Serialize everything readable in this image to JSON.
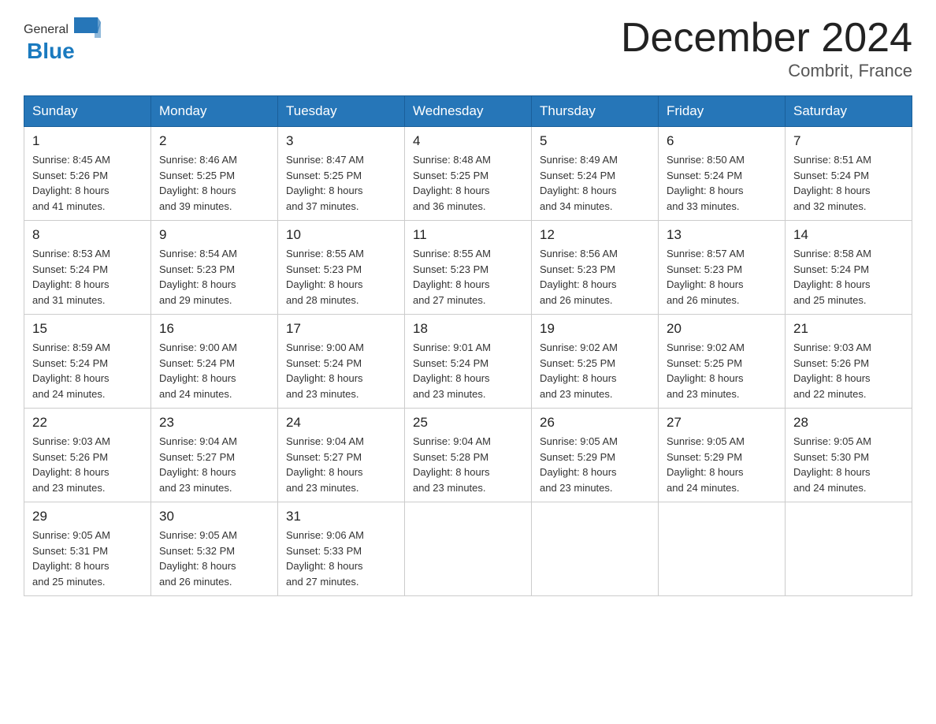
{
  "header": {
    "logo": {
      "general": "General",
      "blue": "Blue",
      "flag_alt": "GeneralBlue logo flag"
    },
    "title": "December 2024",
    "location": "Combrit, France"
  },
  "days_of_week": [
    "Sunday",
    "Monday",
    "Tuesday",
    "Wednesday",
    "Thursday",
    "Friday",
    "Saturday"
  ],
  "weeks": [
    [
      {
        "day": "1",
        "sunrise": "Sunrise: 8:45 AM",
        "sunset": "Sunset: 5:26 PM",
        "daylight": "Daylight: 8 hours",
        "daylight2": "and 41 minutes."
      },
      {
        "day": "2",
        "sunrise": "Sunrise: 8:46 AM",
        "sunset": "Sunset: 5:25 PM",
        "daylight": "Daylight: 8 hours",
        "daylight2": "and 39 minutes."
      },
      {
        "day": "3",
        "sunrise": "Sunrise: 8:47 AM",
        "sunset": "Sunset: 5:25 PM",
        "daylight": "Daylight: 8 hours",
        "daylight2": "and 37 minutes."
      },
      {
        "day": "4",
        "sunrise": "Sunrise: 8:48 AM",
        "sunset": "Sunset: 5:25 PM",
        "daylight": "Daylight: 8 hours",
        "daylight2": "and 36 minutes."
      },
      {
        "day": "5",
        "sunrise": "Sunrise: 8:49 AM",
        "sunset": "Sunset: 5:24 PM",
        "daylight": "Daylight: 8 hours",
        "daylight2": "and 34 minutes."
      },
      {
        "day": "6",
        "sunrise": "Sunrise: 8:50 AM",
        "sunset": "Sunset: 5:24 PM",
        "daylight": "Daylight: 8 hours",
        "daylight2": "and 33 minutes."
      },
      {
        "day": "7",
        "sunrise": "Sunrise: 8:51 AM",
        "sunset": "Sunset: 5:24 PM",
        "daylight": "Daylight: 8 hours",
        "daylight2": "and 32 minutes."
      }
    ],
    [
      {
        "day": "8",
        "sunrise": "Sunrise: 8:53 AM",
        "sunset": "Sunset: 5:24 PM",
        "daylight": "Daylight: 8 hours",
        "daylight2": "and 31 minutes."
      },
      {
        "day": "9",
        "sunrise": "Sunrise: 8:54 AM",
        "sunset": "Sunset: 5:23 PM",
        "daylight": "Daylight: 8 hours",
        "daylight2": "and 29 minutes."
      },
      {
        "day": "10",
        "sunrise": "Sunrise: 8:55 AM",
        "sunset": "Sunset: 5:23 PM",
        "daylight": "Daylight: 8 hours",
        "daylight2": "and 28 minutes."
      },
      {
        "day": "11",
        "sunrise": "Sunrise: 8:55 AM",
        "sunset": "Sunset: 5:23 PM",
        "daylight": "Daylight: 8 hours",
        "daylight2": "and 27 minutes."
      },
      {
        "day": "12",
        "sunrise": "Sunrise: 8:56 AM",
        "sunset": "Sunset: 5:23 PM",
        "daylight": "Daylight: 8 hours",
        "daylight2": "and 26 minutes."
      },
      {
        "day": "13",
        "sunrise": "Sunrise: 8:57 AM",
        "sunset": "Sunset: 5:23 PM",
        "daylight": "Daylight: 8 hours",
        "daylight2": "and 26 minutes."
      },
      {
        "day": "14",
        "sunrise": "Sunrise: 8:58 AM",
        "sunset": "Sunset: 5:24 PM",
        "daylight": "Daylight: 8 hours",
        "daylight2": "and 25 minutes."
      }
    ],
    [
      {
        "day": "15",
        "sunrise": "Sunrise: 8:59 AM",
        "sunset": "Sunset: 5:24 PM",
        "daylight": "Daylight: 8 hours",
        "daylight2": "and 24 minutes."
      },
      {
        "day": "16",
        "sunrise": "Sunrise: 9:00 AM",
        "sunset": "Sunset: 5:24 PM",
        "daylight": "Daylight: 8 hours",
        "daylight2": "and 24 minutes."
      },
      {
        "day": "17",
        "sunrise": "Sunrise: 9:00 AM",
        "sunset": "Sunset: 5:24 PM",
        "daylight": "Daylight: 8 hours",
        "daylight2": "and 23 minutes."
      },
      {
        "day": "18",
        "sunrise": "Sunrise: 9:01 AM",
        "sunset": "Sunset: 5:24 PM",
        "daylight": "Daylight: 8 hours",
        "daylight2": "and 23 minutes."
      },
      {
        "day": "19",
        "sunrise": "Sunrise: 9:02 AM",
        "sunset": "Sunset: 5:25 PM",
        "daylight": "Daylight: 8 hours",
        "daylight2": "and 23 minutes."
      },
      {
        "day": "20",
        "sunrise": "Sunrise: 9:02 AM",
        "sunset": "Sunset: 5:25 PM",
        "daylight": "Daylight: 8 hours",
        "daylight2": "and 23 minutes."
      },
      {
        "day": "21",
        "sunrise": "Sunrise: 9:03 AM",
        "sunset": "Sunset: 5:26 PM",
        "daylight": "Daylight: 8 hours",
        "daylight2": "and 22 minutes."
      }
    ],
    [
      {
        "day": "22",
        "sunrise": "Sunrise: 9:03 AM",
        "sunset": "Sunset: 5:26 PM",
        "daylight": "Daylight: 8 hours",
        "daylight2": "and 23 minutes."
      },
      {
        "day": "23",
        "sunrise": "Sunrise: 9:04 AM",
        "sunset": "Sunset: 5:27 PM",
        "daylight": "Daylight: 8 hours",
        "daylight2": "and 23 minutes."
      },
      {
        "day": "24",
        "sunrise": "Sunrise: 9:04 AM",
        "sunset": "Sunset: 5:27 PM",
        "daylight": "Daylight: 8 hours",
        "daylight2": "and 23 minutes."
      },
      {
        "day": "25",
        "sunrise": "Sunrise: 9:04 AM",
        "sunset": "Sunset: 5:28 PM",
        "daylight": "Daylight: 8 hours",
        "daylight2": "and 23 minutes."
      },
      {
        "day": "26",
        "sunrise": "Sunrise: 9:05 AM",
        "sunset": "Sunset: 5:29 PM",
        "daylight": "Daylight: 8 hours",
        "daylight2": "and 23 minutes."
      },
      {
        "day": "27",
        "sunrise": "Sunrise: 9:05 AM",
        "sunset": "Sunset: 5:29 PM",
        "daylight": "Daylight: 8 hours",
        "daylight2": "and 24 minutes."
      },
      {
        "day": "28",
        "sunrise": "Sunrise: 9:05 AM",
        "sunset": "Sunset: 5:30 PM",
        "daylight": "Daylight: 8 hours",
        "daylight2": "and 24 minutes."
      }
    ],
    [
      {
        "day": "29",
        "sunrise": "Sunrise: 9:05 AM",
        "sunset": "Sunset: 5:31 PM",
        "daylight": "Daylight: 8 hours",
        "daylight2": "and 25 minutes."
      },
      {
        "day": "30",
        "sunrise": "Sunrise: 9:05 AM",
        "sunset": "Sunset: 5:32 PM",
        "daylight": "Daylight: 8 hours",
        "daylight2": "and 26 minutes."
      },
      {
        "day": "31",
        "sunrise": "Sunrise: 9:06 AM",
        "sunset": "Sunset: 5:33 PM",
        "daylight": "Daylight: 8 hours",
        "daylight2": "and 27 minutes."
      },
      null,
      null,
      null,
      null
    ]
  ]
}
